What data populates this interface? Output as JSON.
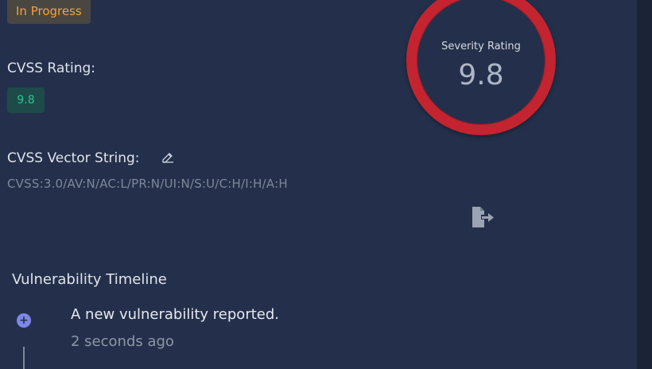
{
  "status": {
    "label": "In Progress"
  },
  "cvss": {
    "label": "CVSS Rating:",
    "score": "9.8"
  },
  "vector": {
    "label": "CVSS Vector String:",
    "value": "CVSS:3.0/AV:N/AC:L/PR:N/UI:N/S:U/C:H/I:H/A:H"
  },
  "gauge": {
    "title": "Severity Rating",
    "value": "9.8"
  },
  "timeline": {
    "heading": "Vulnerability Timeline",
    "events": [
      {
        "title": "A new vulnerability reported.",
        "time": "2 seconds ago"
      }
    ]
  },
  "colors": {
    "background": "#24304b",
    "status_text": "#f0a33c",
    "cvss_green": "#2bc48a",
    "severity_red": "#c4242f",
    "timeline_dot": "#7f86ea"
  },
  "icons": {
    "edit": "edit-icon",
    "export": "export-icon",
    "timeline_dot": "plus-circle-icon"
  }
}
